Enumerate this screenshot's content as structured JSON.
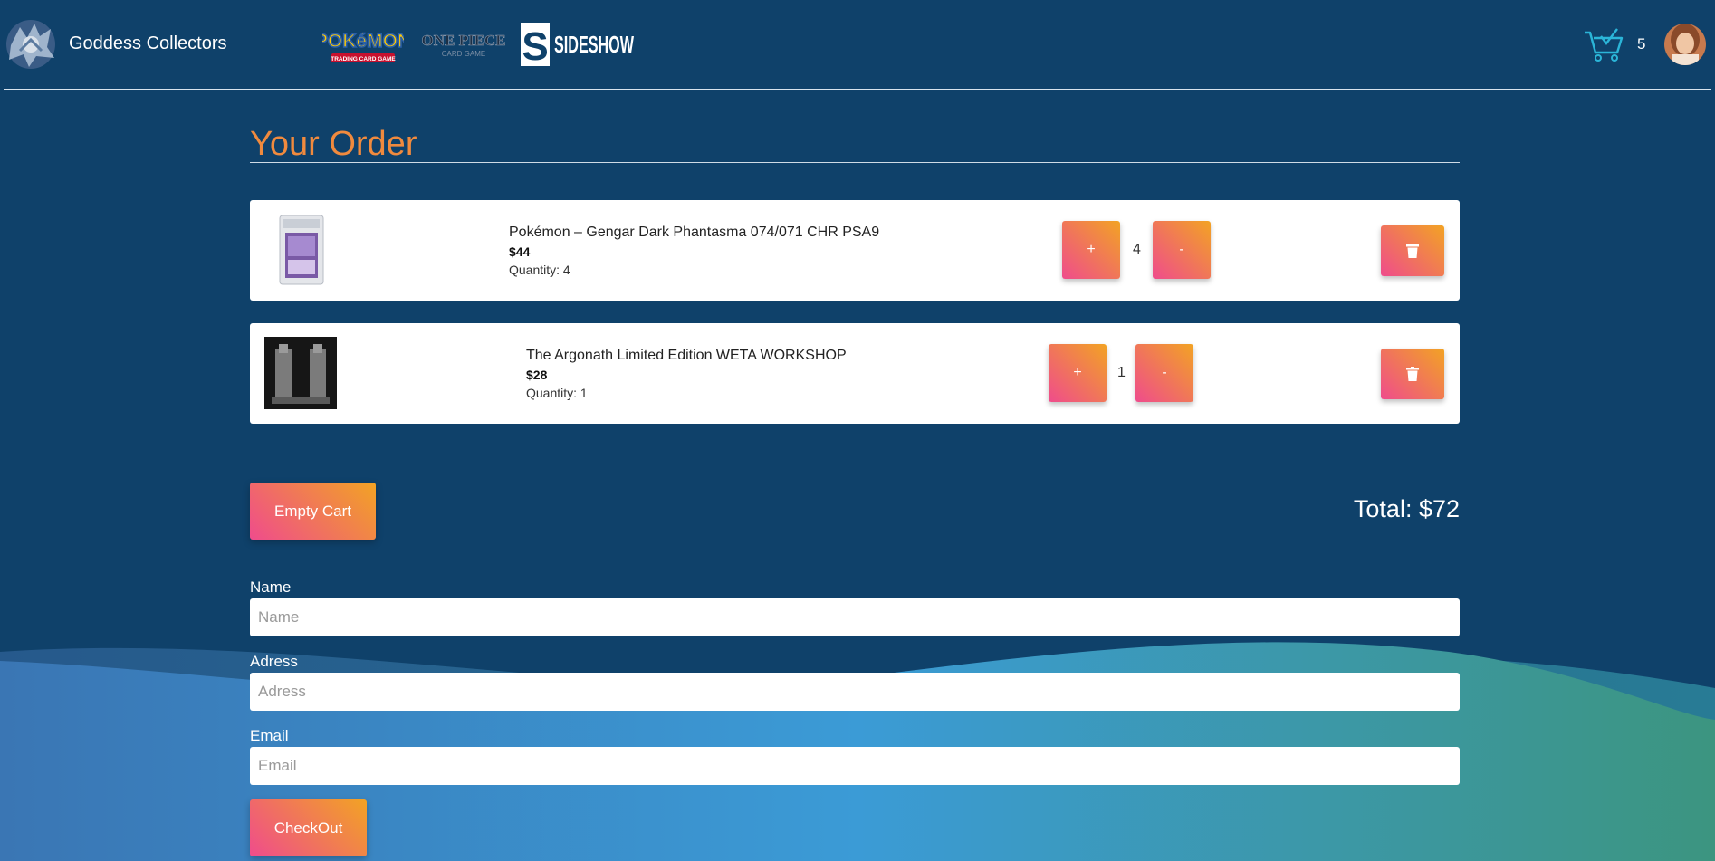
{
  "header": {
    "brand_name": "Goddess Collectors",
    "logos": [
      "pokemon-tcg-logo",
      "one-piece-card-game-logo",
      "sideshow-logo"
    ],
    "pokemon_text": "POKéMON",
    "pokemon_sub": "TRADING CARD GAME",
    "onepiece_text": "ONE PIECE",
    "onepiece_sub": "CARD GAME",
    "sideshow_letter": "S",
    "sideshow_text": "SIDESHOW",
    "cart_count": "5"
  },
  "order": {
    "title": "Your Order",
    "items": [
      {
        "name": "Pokémon – Gengar Dark Phantasma 074/071 CHR PSA9",
        "price": "$44",
        "quantity_text": "Quantity: 4",
        "quantity": "4",
        "plus_label": "+",
        "minus_label": "-"
      },
      {
        "name": "The Argonath Limited Edition WETA WORKSHOP",
        "price": "$28",
        "quantity_text": "Quantity: 1",
        "quantity": "1",
        "plus_label": "+",
        "minus_label": "-"
      }
    ],
    "empty_cart_label": "Empty Cart",
    "total": "Total: $72"
  },
  "form": {
    "name_label": "Name",
    "name_placeholder": "Name",
    "address_label": "Adress",
    "address_placeholder": "Adress",
    "email_label": "Email",
    "email_placeholder": "Email",
    "checkout_label": "CheckOut"
  },
  "colors": {
    "background": "#0f416a",
    "title_accent": "#f08a3e",
    "button_gradient_start": "#ef4c8c",
    "button_gradient_end": "#f2a324",
    "cart_icon": "#2bb5d8"
  }
}
